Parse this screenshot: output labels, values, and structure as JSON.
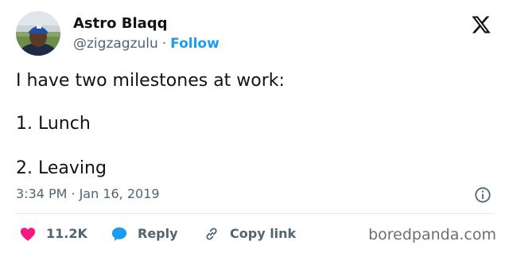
{
  "author": {
    "name": "Astro Blaqq",
    "handle": "@zigzagzulu",
    "separator": "·",
    "follow_label": "Follow"
  },
  "tweet": {
    "lines": [
      "I have two milestones at work:",
      "1. Lunch",
      "2. Leaving"
    ],
    "time": "3:34 PM",
    "separator": "·",
    "date": "Jan 16, 2019"
  },
  "actions": {
    "likes": "11.2K",
    "reply_label": "Reply",
    "copy_label": "Copy link"
  },
  "watermark": "boredpanda.com",
  "colors": {
    "like": "#f91880",
    "reply": "#1d9bf0",
    "follow": "#1d9bf0",
    "muted": "#536471",
    "text": "#0f1419"
  },
  "icons": {
    "logo": "x-logo-icon",
    "info": "info-icon",
    "like": "heart-icon",
    "reply": "speech-bubble-icon",
    "copy": "link-icon"
  }
}
